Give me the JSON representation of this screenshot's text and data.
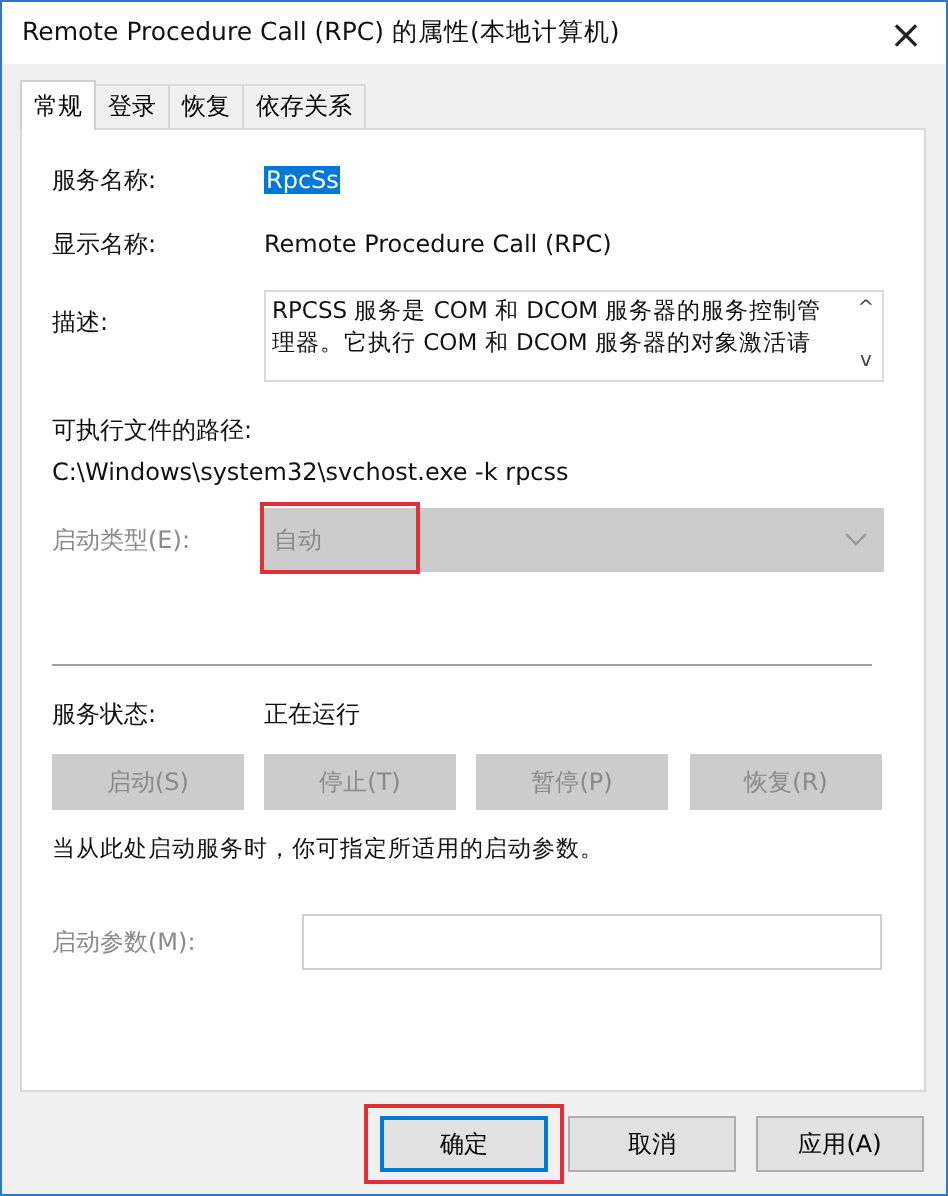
{
  "window": {
    "title": "Remote Procedure Call (RPC) 的属性(本地计算机)",
    "close": "×"
  },
  "tabs": [
    {
      "label": "常规",
      "selected": true
    },
    {
      "label": "登录",
      "selected": false
    },
    {
      "label": "恢复",
      "selected": false
    },
    {
      "label": "依存关系",
      "selected": false
    }
  ],
  "service_name": {
    "label": "服务名称:",
    "value": "RpcSs",
    "selected": true
  },
  "display_name": {
    "label": "显示名称:",
    "value": "Remote Procedure Call (RPC)"
  },
  "description": {
    "label": "描述:",
    "value": "RPCSS 服务是 COM 和 DCOM 服务器的服务控制管理器。它执行 COM 和 DCOM 服务器的对象激活请",
    "scroll_up": "^",
    "scroll_down": "v"
  },
  "executable_path": {
    "label": "可执行文件的路径:",
    "value": "C:\\Windows\\system32\\svchost.exe -k rpcss"
  },
  "startup_type": {
    "label": "启动类型(E):",
    "value": "自动",
    "disabled": true,
    "highlighted": true
  },
  "service_status": {
    "label": "服务状态:",
    "value": "正在运行"
  },
  "control_buttons": [
    {
      "label": "启动(S)",
      "disabled": true
    },
    {
      "label": "停止(T)",
      "disabled": true
    },
    {
      "label": "暂停(P)",
      "disabled": true
    },
    {
      "label": "恢复(R)",
      "disabled": true
    }
  ],
  "hint": "当从此处启动服务时，你可指定所适用的启动参数。",
  "start_parameters": {
    "label": "启动参数(M):",
    "disabled": true
  },
  "dialog_buttons": [
    {
      "label": "确定",
      "focused": true,
      "highlighted": true
    },
    {
      "label": "取消",
      "focused": false,
      "highlighted": false
    },
    {
      "label": "应用(A)",
      "focused": false,
      "highlighted": false
    }
  ]
}
